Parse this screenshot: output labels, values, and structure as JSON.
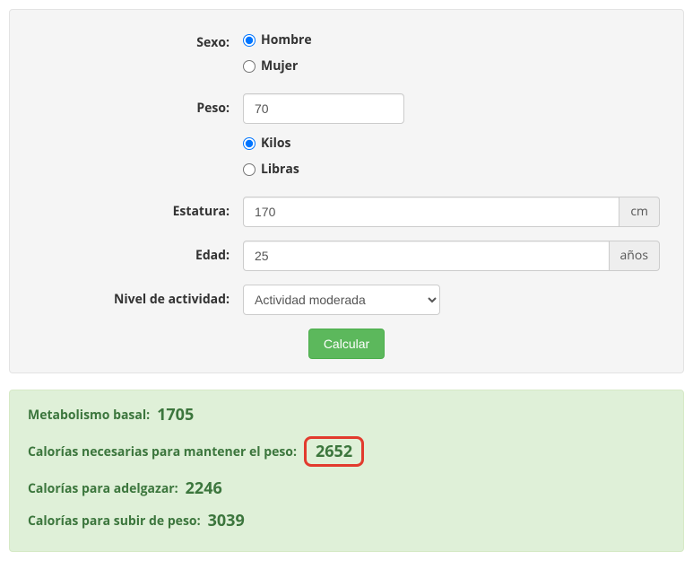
{
  "form": {
    "sexo": {
      "label": "Sexo:",
      "options": {
        "hombre": "Hombre",
        "mujer": "Mujer"
      },
      "selected": "hombre"
    },
    "peso": {
      "label": "Peso:",
      "value": "70",
      "units": {
        "kilos": "Kilos",
        "libras": "Libras"
      },
      "unitSelected": "kilos"
    },
    "estatura": {
      "label": "Estatura:",
      "value": "170",
      "unit": "cm"
    },
    "edad": {
      "label": "Edad:",
      "value": "25",
      "unit": "años"
    },
    "actividad": {
      "label": "Nivel de actividad:",
      "selected": "Actividad moderada",
      "options": [
        "Actividad moderada"
      ]
    },
    "submit": "Calcular"
  },
  "results": {
    "basal": {
      "label": "Metabolismo basal:",
      "value": "1705"
    },
    "mantener": {
      "label": "Calorías necesarias para mantener el peso:",
      "value": "2652"
    },
    "adelgazar": {
      "label": "Calorías para adelgazar:",
      "value": "2246"
    },
    "subir": {
      "label": "Calorías para subir de peso:",
      "value": "3039"
    }
  }
}
